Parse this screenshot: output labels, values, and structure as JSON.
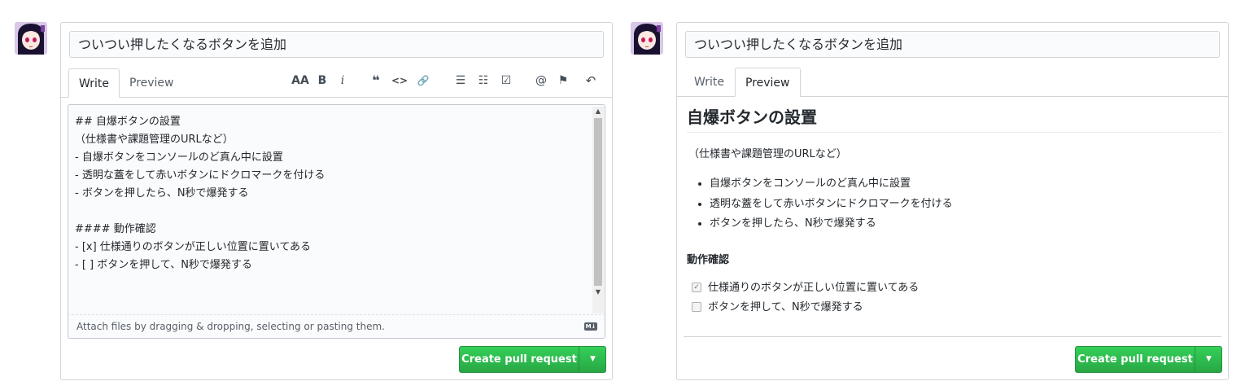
{
  "left": {
    "title_value": "ついつい押したくなるボタンを追加",
    "tabs": [
      {
        "label": "Write"
      },
      {
        "label": "Preview"
      }
    ],
    "toolbar": {
      "header": "AA",
      "bold": "B",
      "italic": "i",
      "quote": "❝",
      "code": "<>",
      "link": "🔗",
      "ul": "☰",
      "ol": "☷",
      "tasks": "☑",
      "mention": "@",
      "saved": "⚑",
      "reply": "↶"
    },
    "editor_lines": [
      "## 自爆ボタンの設置",
      "（仕様書や課題管理のURLなど）",
      "- 自爆ボタンをコンソールのど真ん中に設置",
      "- 透明な蓋をして赤いボタンにドクロマークを付ける",
      "- ボタンを押したら、N秒で爆発する",
      "",
      "#### 動作確認",
      "- [x] 仕様通りのボタンが正しい位置に置いてある",
      "- [ ] ボタンを押して、N秒で爆発する"
    ],
    "attach_text": "Attach files by dragging & dropping, selecting or pasting them.",
    "md_badge": "M↓",
    "submit_label": "Create pull request",
    "caret": "▼"
  },
  "right": {
    "title_value": "ついつい押したくなるボタンを追加",
    "tabs": [
      {
        "label": "Write"
      },
      {
        "label": "Preview"
      }
    ],
    "heading": "自爆ボタンの設置",
    "paragraph": "（仕様書や課題管理のURLなど）",
    "list": [
      "自爆ボタンをコンソールのど真ん中に設置",
      "透明な蓋をして赤いボタンにドクロマークを付ける",
      "ボタンを押したら、N秒で爆発する"
    ],
    "subheading": "動作確認",
    "tasks": [
      {
        "checked": true,
        "label": "仕様通りのボタンが正しい位置に置いてある"
      },
      {
        "checked": false,
        "label": "ボタンを押して、N秒で爆発する"
      }
    ],
    "submit_label": "Create pull request",
    "caret": "▼"
  },
  "colors": {
    "accent_green": "#2ea44f",
    "border": "#d1d5da"
  }
}
